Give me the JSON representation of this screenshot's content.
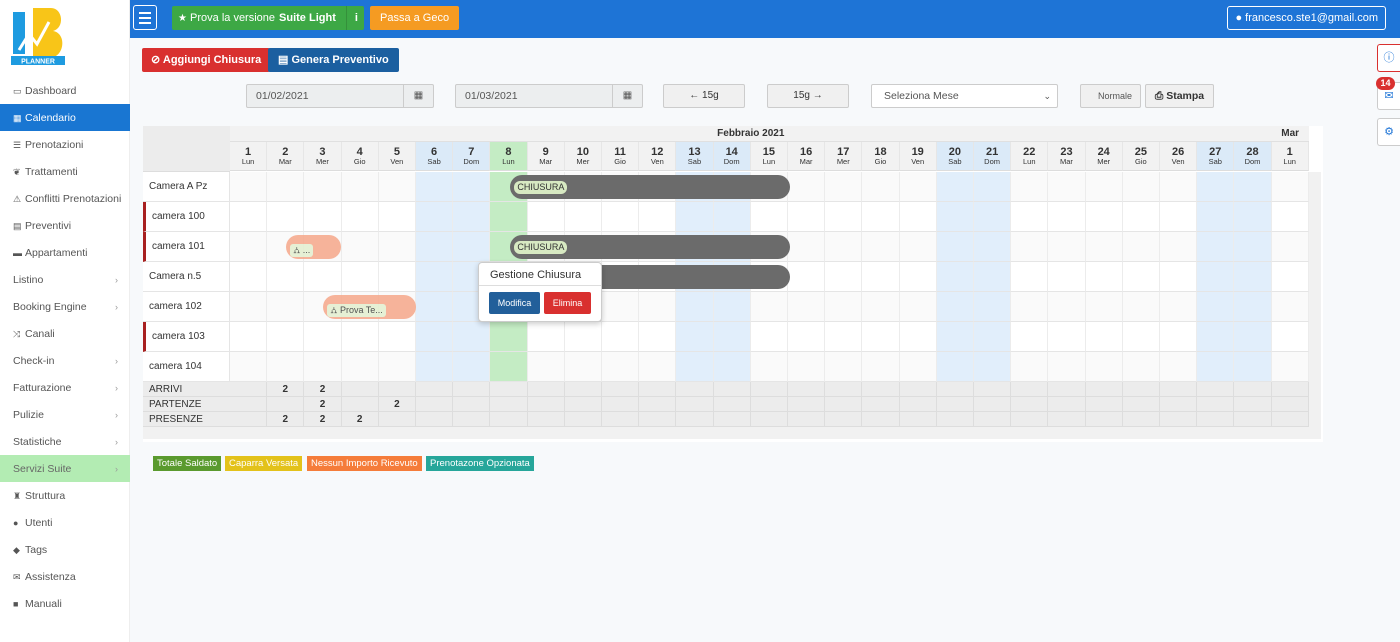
{
  "topbar": {
    "suite_prefix": "Prova la versione",
    "suite_bold": "Suite Light",
    "suite_info": "i",
    "geco": "Passa a Geco",
    "user": "francesco.ste1@gmail.com"
  },
  "logo_text": "PLANNER",
  "sidebar": {
    "items": [
      {
        "label": "Dashboard",
        "icon": "▭",
        "state": "normal",
        "chevron": false
      },
      {
        "label": "Calendario",
        "icon": "▦",
        "state": "active",
        "chevron": false
      },
      {
        "label": "Prenotazioni",
        "icon": "☰",
        "state": "normal",
        "chevron": false
      },
      {
        "label": "Trattamenti",
        "icon": "❦",
        "state": "normal",
        "chevron": false
      },
      {
        "label": "Conflitti Prenotazioni",
        "icon": "⚠",
        "state": "normal",
        "chevron": false
      },
      {
        "label": "Preventivi",
        "icon": "▤",
        "state": "normal",
        "chevron": false
      },
      {
        "label": "Appartamenti",
        "icon": "▬",
        "state": "normal",
        "chevron": false
      },
      {
        "label": "Listino",
        "icon": "",
        "state": "normal",
        "chevron": true
      },
      {
        "label": "Booking Engine",
        "icon": "",
        "state": "normal",
        "chevron": true
      },
      {
        "label": "Canali",
        "icon": "⤨",
        "state": "normal",
        "chevron": false
      },
      {
        "label": "Check-in",
        "icon": "",
        "state": "normal",
        "chevron": true
      },
      {
        "label": "Fatturazione",
        "icon": "",
        "state": "normal",
        "chevron": true
      },
      {
        "label": "Pulizie",
        "icon": "",
        "state": "normal",
        "chevron": true
      },
      {
        "label": "Statistiche",
        "icon": "",
        "state": "normal",
        "chevron": true
      },
      {
        "label": "Servizi Suite",
        "icon": "",
        "state": "green",
        "chevron": true
      },
      {
        "label": "Struttura",
        "icon": "♜",
        "state": "normal",
        "chevron": false
      },
      {
        "label": "Utenti",
        "icon": "●",
        "state": "normal",
        "chevron": false
      },
      {
        "label": "Tags",
        "icon": "◆",
        "state": "normal",
        "chevron": false
      },
      {
        "label": "Assistenza",
        "icon": "✉",
        "state": "normal",
        "chevron": false
      },
      {
        "label": "Manuali",
        "icon": "■",
        "state": "normal",
        "chevron": false
      }
    ]
  },
  "toolbar": {
    "add_closure": "Aggiungi Chiusura",
    "quote": "Genera Preventivo",
    "date_from": "01/02/2021",
    "date_to": "01/03/2021",
    "prev": "15g",
    "next": "15g",
    "month_select": "Seleziona Mese",
    "mode": "Normale",
    "print": "Stampa"
  },
  "notifications": {
    "count": "14"
  },
  "calendar": {
    "month_label": "Febbraio 2021",
    "next_month_label": "Mar",
    "days": [
      {
        "n": "1",
        "w": "Lun",
        "t": ""
      },
      {
        "n": "2",
        "w": "Mar",
        "t": ""
      },
      {
        "n": "3",
        "w": "Mer",
        "t": ""
      },
      {
        "n": "4",
        "w": "Gio",
        "t": ""
      },
      {
        "n": "5",
        "w": "Ven",
        "t": ""
      },
      {
        "n": "6",
        "w": "Sab",
        "t": "we"
      },
      {
        "n": "7",
        "w": "Dom",
        "t": "we"
      },
      {
        "n": "8",
        "w": "Lun",
        "t": "today"
      },
      {
        "n": "9",
        "w": "Mar",
        "t": ""
      },
      {
        "n": "10",
        "w": "Mer",
        "t": ""
      },
      {
        "n": "11",
        "w": "Gio",
        "t": ""
      },
      {
        "n": "12",
        "w": "Ven",
        "t": ""
      },
      {
        "n": "13",
        "w": "Sab",
        "t": "we"
      },
      {
        "n": "14",
        "w": "Dom",
        "t": "we"
      },
      {
        "n": "15",
        "w": "Lun",
        "t": ""
      },
      {
        "n": "16",
        "w": "Mar",
        "t": ""
      },
      {
        "n": "17",
        "w": "Mer",
        "t": ""
      },
      {
        "n": "18",
        "w": "Gio",
        "t": ""
      },
      {
        "n": "19",
        "w": "Ven",
        "t": ""
      },
      {
        "n": "20",
        "w": "Sab",
        "t": "we"
      },
      {
        "n": "21",
        "w": "Dom",
        "t": "we"
      },
      {
        "n": "22",
        "w": "Lun",
        "t": ""
      },
      {
        "n": "23",
        "w": "Mar",
        "t": ""
      },
      {
        "n": "24",
        "w": "Mer",
        "t": ""
      },
      {
        "n": "25",
        "w": "Gio",
        "t": ""
      },
      {
        "n": "26",
        "w": "Ven",
        "t": ""
      },
      {
        "n": "27",
        "w": "Sab",
        "t": "we"
      },
      {
        "n": "28",
        "w": "Dom",
        "t": "we"
      },
      {
        "n": "1",
        "w": "Lun",
        "t": ""
      }
    ],
    "rooms": [
      {
        "name": "Camera A Pz",
        "marker": false
      },
      {
        "name": "camera 100",
        "marker": true
      },
      {
        "name": "camera 101",
        "marker": true
      },
      {
        "name": "Camera n.5",
        "marker": false
      },
      {
        "name": "camera 102",
        "marker": false
      },
      {
        "name": "camera 103",
        "marker": true
      },
      {
        "name": "camera 104",
        "marker": false
      }
    ],
    "closures": [
      {
        "room": 0,
        "from": 7,
        "to": 14,
        "label": "CHIUSURA"
      },
      {
        "room": 2,
        "from": 7,
        "to": 14,
        "label": "CHIUSURA"
      },
      {
        "room": 3,
        "from": 7,
        "to": 14,
        "label": ""
      }
    ],
    "bookings": [
      {
        "room": 2,
        "from": 1,
        "to": 2,
        "label": "..."
      },
      {
        "room": 4,
        "from": 2,
        "to": 4,
        "label": "Prova Te..."
      }
    ],
    "summary": [
      {
        "label": "ARRIVI",
        "values": {
          "1": "2",
          "2": "2"
        }
      },
      {
        "label": "PARTENZE",
        "values": {
          "2": "2",
          "4": "2"
        }
      },
      {
        "label": "PRESENZE",
        "values": {
          "1": "2",
          "2": "2",
          "3": "2"
        }
      }
    ]
  },
  "popup": {
    "title": "Gestione Chiusura",
    "edit": "Modifica",
    "delete": "Elimina"
  },
  "legend": [
    {
      "label": "Totale Saldato",
      "color": "#5a9a2e"
    },
    {
      "label": "Caparra Versata",
      "color": "#e3c21a"
    },
    {
      "label": "Nessun Importo Ricevuto",
      "color": "#f57c3a"
    },
    {
      "label": "Prenotazone Opzionata",
      "color": "#26a69a"
    }
  ]
}
